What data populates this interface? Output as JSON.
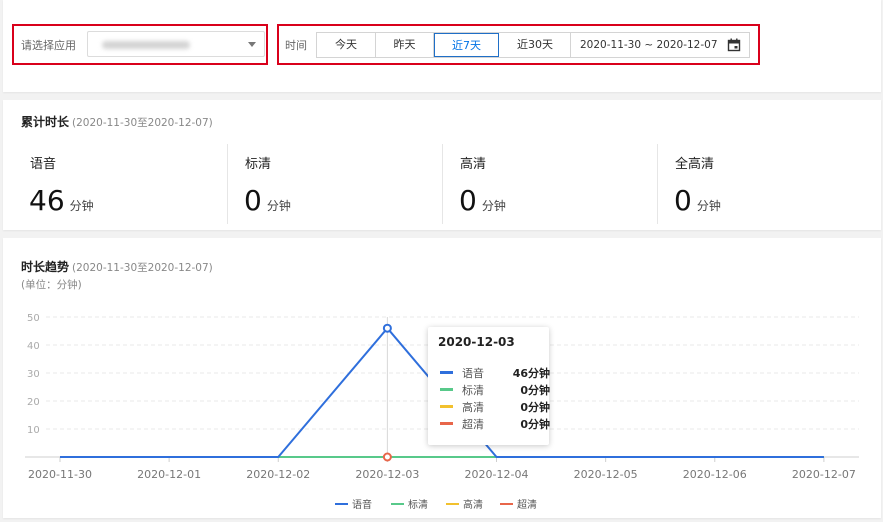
{
  "filter": {
    "app_label": "请选择应用",
    "app_value": "",
    "time_label": "时间",
    "ranges": [
      {
        "label": "今天",
        "active": false
      },
      {
        "label": "昨天",
        "active": false
      },
      {
        "label": "近7天",
        "active": true
      },
      {
        "label": "近30天",
        "active": false
      }
    ],
    "date_range": "2020-11-30 ~ 2020-12-07"
  },
  "total": {
    "title": "累计时长",
    "period": "(2020-11-30至2020-12-07)",
    "unit": "分钟",
    "stats": [
      {
        "label": "语音",
        "value": "46"
      },
      {
        "label": "标清",
        "value": "0"
      },
      {
        "label": "高清",
        "value": "0"
      },
      {
        "label": "全高清",
        "value": "0"
      }
    ]
  },
  "trend": {
    "title": "时长趋势",
    "period": "(2020-11-30至2020-12-07)",
    "unit_note": "(单位：分钟)",
    "tooltip": {
      "date": "2020-12-03",
      "rows": [
        {
          "name": "语音",
          "value": "46分钟"
        },
        {
          "name": "标清",
          "value": "0分钟"
        },
        {
          "name": "高清",
          "value": "0分钟"
        },
        {
          "name": "超清",
          "value": "0分钟"
        }
      ]
    }
  },
  "colors": {
    "accent": "#0073e6",
    "highlight_border": "#d9001b",
    "voice": "#2f6fdc",
    "sd": "#58c98a",
    "hd": "#f2c12e",
    "uhd": "#e8664a"
  },
  "chart_data": {
    "type": "line",
    "x": [
      "2020-11-30",
      "2020-12-01",
      "2020-12-02",
      "2020-12-03",
      "2020-12-04",
      "2020-12-05",
      "2020-12-06",
      "2020-12-07"
    ],
    "yticks": [
      10,
      20,
      30,
      40,
      50
    ],
    "ylim": [
      0,
      50
    ],
    "series": [
      {
        "name": "语音",
        "color": "#2f6fdc",
        "values": [
          0,
          0,
          0,
          46,
          0,
          0,
          0,
          0
        ]
      },
      {
        "name": "标清",
        "color": "#58c98a",
        "values": [
          0,
          0,
          0,
          0,
          0,
          0,
          0,
          0
        ]
      },
      {
        "name": "高清",
        "color": "#f2c12e",
        "values": [
          0,
          0,
          0,
          0,
          0,
          0,
          0,
          0
        ]
      },
      {
        "name": "超清",
        "color": "#e8664a",
        "values": [
          0,
          0,
          0,
          0,
          0,
          0,
          0,
          0
        ]
      }
    ],
    "highlight_index": 3,
    "grid": true,
    "legend_position": "bottom"
  }
}
